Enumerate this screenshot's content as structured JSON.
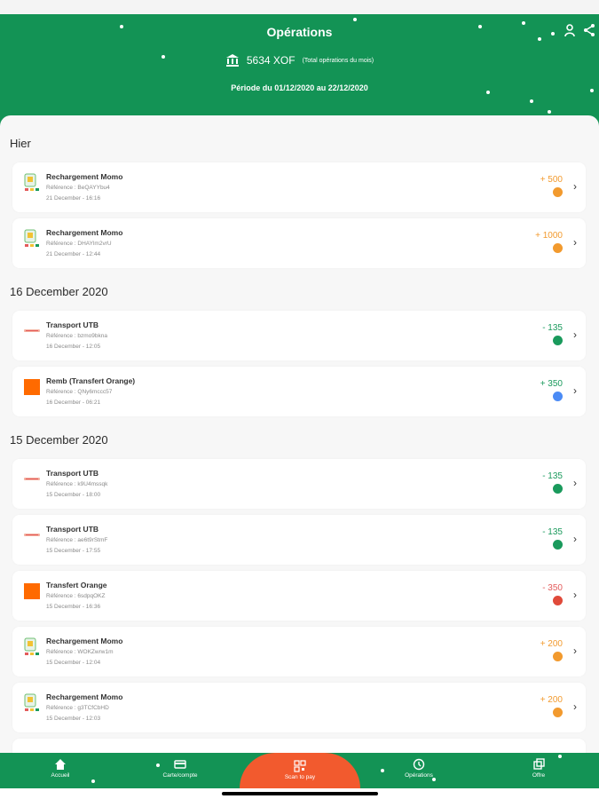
{
  "header": {
    "title": "Opérations",
    "total_amount": "5634 XOF",
    "total_note": "(Total opérations du mois)",
    "period": "Période du 01/12/2020 au 22/12/2020"
  },
  "sections": [
    {
      "title": "Hier",
      "items": [
        {
          "name": "Rechargement Momo",
          "ref": "Référence : BeQAYYbu4",
          "date": "21 December - 16:16",
          "amount": "+ 500",
          "amount_color": "#f29a2e",
          "status": "pending"
        },
        {
          "name": "Rechargement Momo",
          "ref": "Référence : DHAYlm2vrU",
          "date": "21 December - 12:44",
          "amount": "+ 1000",
          "amount_color": "#f29a2e",
          "status": "pending"
        }
      ]
    },
    {
      "title": "16 December 2020",
      "items": [
        {
          "name": "Transport UTB",
          "ref": "Référence : bzmo9bkna",
          "date": "16 December - 12:05",
          "amount": "- 135",
          "amount_color": "#1a9a5c",
          "status": "success"
        },
        {
          "name": "Remb (Transfert Orange)",
          "ref": "Référence : QNy6mccc57",
          "date": "16 December - 06:21",
          "amount": "+ 350",
          "amount_color": "#1a9a5c",
          "status": "refund"
        }
      ]
    },
    {
      "title": "15 December 2020",
      "items": [
        {
          "name": "Transport UTB",
          "ref": "Référence : k9U4mssqk",
          "date": "15 December - 18:00",
          "amount": "- 135",
          "amount_color": "#1a9a5c",
          "status": "success"
        },
        {
          "name": "Transport UTB",
          "ref": "Référence : ae6t9rStmF",
          "date": "15 December - 17:55",
          "amount": "- 135",
          "amount_color": "#1a9a5c",
          "status": "success"
        },
        {
          "name": "Transfert Orange",
          "ref": "Référence : 6sdpqOKZ",
          "date": "15 December - 16:36",
          "amount": "- 350",
          "amount_color": "#e35b5b",
          "status": "failed"
        },
        {
          "name": "Rechargement Momo",
          "ref": "Référence : WOKZwrw1m",
          "date": "15 December - 12:04",
          "amount": "+ 200",
          "amount_color": "#f29a2e",
          "status": "pending"
        },
        {
          "name": "Rechargement Momo",
          "ref": "Référence : g3TCfCbHD",
          "date": "15 December - 12:03",
          "amount": "+ 200",
          "amount_color": "#f29a2e",
          "status": "pending"
        }
      ]
    }
  ],
  "footer": {
    "tabs": [
      {
        "label": "Accueil",
        "icon": "home-icon"
      },
      {
        "label": "Carte/compte",
        "icon": "card-icon"
      },
      {
        "label": "Scan to pay",
        "icon": "qr-icon"
      },
      {
        "label": "Opérations",
        "icon": "clock-icon"
      },
      {
        "label": "Offre",
        "icon": "offers-icon"
      }
    ]
  },
  "colors": {
    "brand_green": "#139355",
    "scan_orange": "#f25a2e",
    "amount_orange": "#f29a2e",
    "amount_green": "#1a9a5c",
    "amount_red": "#e35b5b"
  }
}
